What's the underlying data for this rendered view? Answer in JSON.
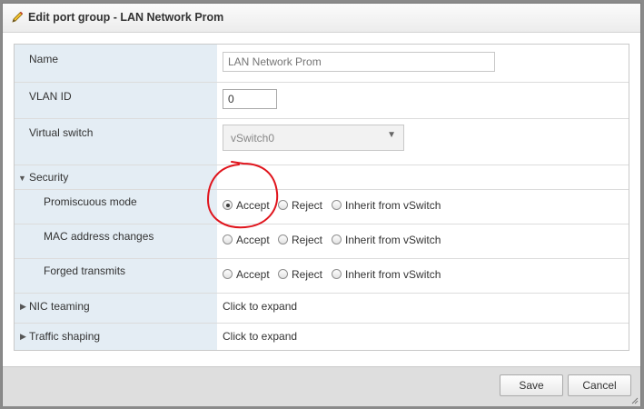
{
  "dialog": {
    "title": "Edit port group - LAN Network Prom",
    "icon": "pencil-icon"
  },
  "fields": {
    "name": {
      "label": "Name",
      "placeholder": "LAN Network Prom",
      "value": ""
    },
    "vlan": {
      "label": "VLAN ID",
      "value": "0"
    },
    "vswitch": {
      "label": "Virtual switch",
      "selected": "vSwitch0"
    }
  },
  "security": {
    "label": "Security",
    "options": {
      "accept": "Accept",
      "reject": "Reject",
      "inherit": "Inherit from vSwitch"
    },
    "rows": [
      {
        "label": "Promiscuous mode",
        "selected": "accept"
      },
      {
        "label": "MAC address changes",
        "selected": ""
      },
      {
        "label": "Forged transmits",
        "selected": ""
      }
    ]
  },
  "sections": {
    "nic": {
      "label": "NIC teaming",
      "value": "Click to expand"
    },
    "traffic": {
      "label": "Traffic shaping",
      "value": "Click to expand"
    }
  },
  "buttons": {
    "save": "Save",
    "cancel": "Cancel"
  },
  "colors": {
    "label_bg": "#e4edf4",
    "annotation": "#e0141c"
  }
}
